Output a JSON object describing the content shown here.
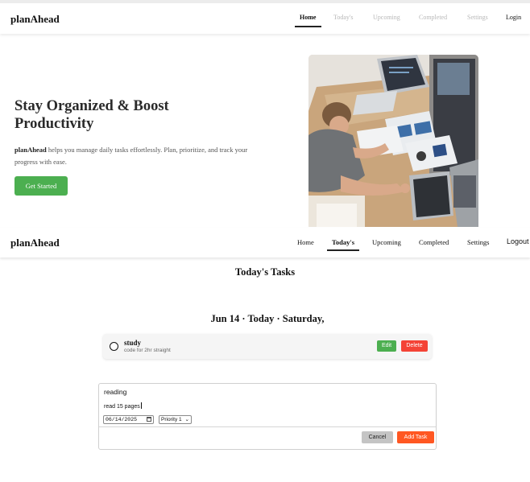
{
  "colors": {
    "primary_green": "#4caf50",
    "delete_red": "#f44336",
    "add_orange": "#ff5722",
    "cancel_gray": "#c4c4c4",
    "inactive_link": "#b8b8b8"
  },
  "landing_nav": {
    "brand": "planAhead",
    "links": [
      "Home",
      "Today's",
      "Upcoming",
      "Completed",
      "Settings",
      "Login"
    ],
    "active": "Home"
  },
  "hero": {
    "title_line1": "Stay Organized & Boost",
    "title_line2": "Productivity",
    "desc_brand": "planAhead",
    "desc_text": " helps you manage daily tasks effortlessly. Plan, prioritize, and track your progress with ease.",
    "cta_label": "Get Started",
    "image": "photo-person-working-at-desk-with-laptops"
  },
  "app_nav": {
    "brand": "planAhead",
    "links": [
      "Home",
      "Today's",
      "Upcoming",
      "Completed",
      "Settings",
      "Logout"
    ],
    "active": "Today's"
  },
  "today": {
    "page_title": "Today's Tasks",
    "date_heading": "Jun 14 · Today · Saturday,",
    "tasks": [
      {
        "title": "study",
        "description": "code for 2hr straight",
        "edit_label": "Edit",
        "delete_label": "Delete",
        "check_icon": "empty-circle-icon"
      }
    ]
  },
  "add_form": {
    "title_value": "reading",
    "description_value": "read 15 pages",
    "date_value": "06/14/2025",
    "date_icon": "calendar-icon",
    "priority_value": "Priority 1",
    "priority_icon": "chevron-down-icon",
    "cancel_label": "Cancel",
    "add_label": "Add Task"
  }
}
